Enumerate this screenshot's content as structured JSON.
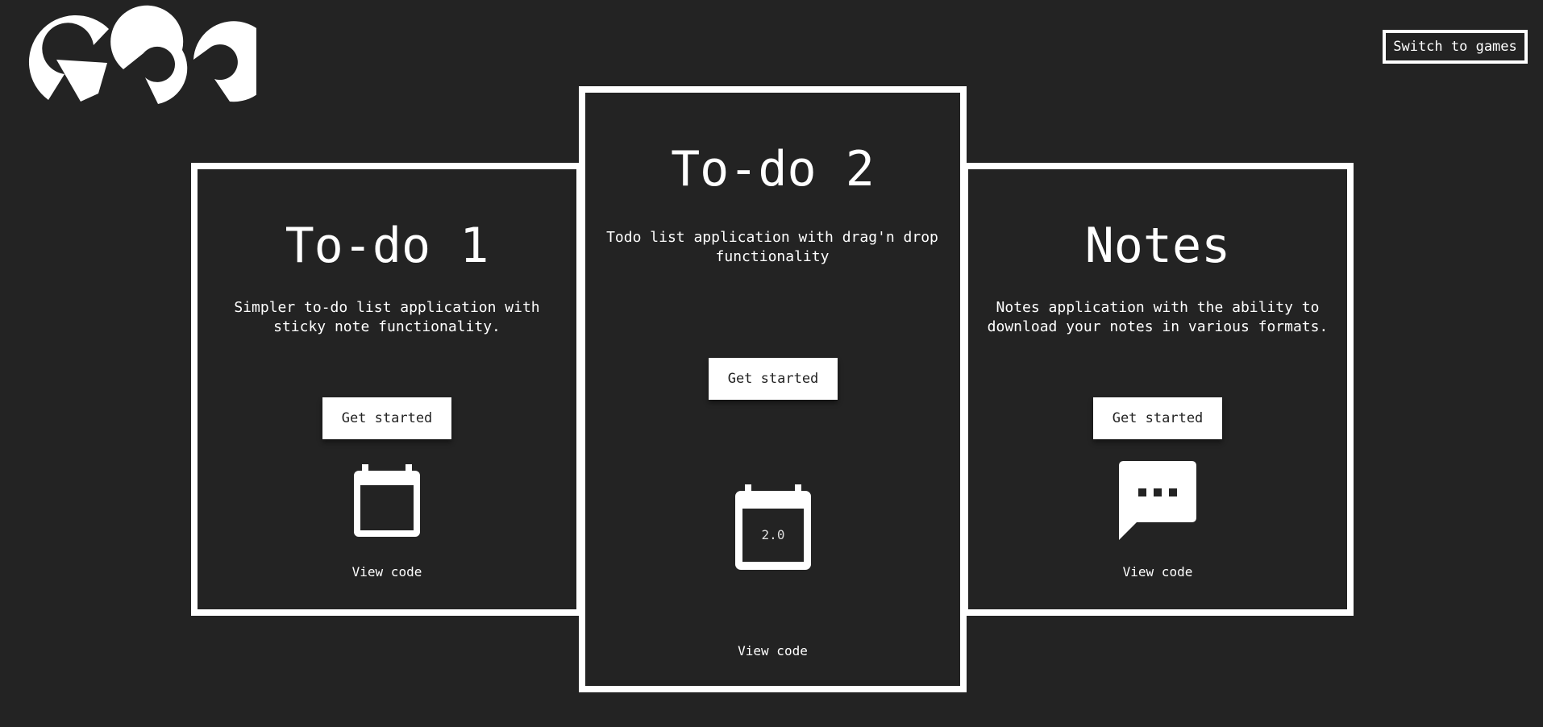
{
  "header": {
    "logo_name": "grr-logo",
    "switch_label": "Switch to games"
  },
  "cards": [
    {
      "title": "To-do 1",
      "description": "Simpler to-do list application with sticky note functionality.",
      "cta_label": "Get started",
      "icon": "calendar-icon",
      "link_label": "View code"
    },
    {
      "title": "To-do 2",
      "description": "Todo list application with drag'n drop functionality",
      "cta_label": "Get started",
      "icon": "calendar-version-icon",
      "icon_text": "2.0",
      "link_label": "View code"
    },
    {
      "title": "Notes",
      "description": "Notes application with the ability to download your notes in various formats.",
      "cta_label": "Get started",
      "icon": "chat-bubble-icon",
      "link_label": "View code"
    }
  ],
  "colors": {
    "background": "#232323",
    "foreground": "#ffffff"
  }
}
